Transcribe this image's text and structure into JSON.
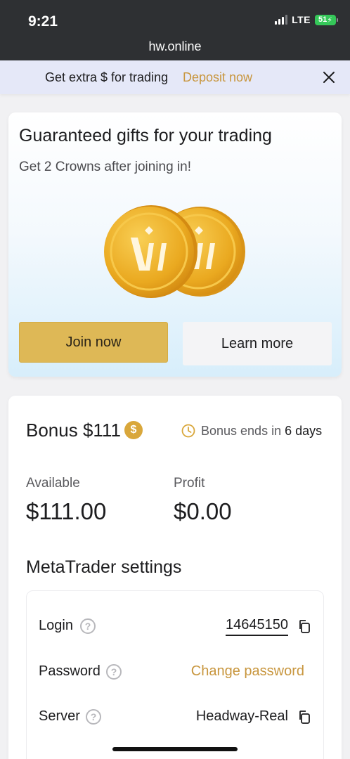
{
  "status_bar": {
    "time": "9:21",
    "network": "LTE",
    "battery": "51"
  },
  "browser": {
    "url": "hw.online"
  },
  "promo": {
    "text": "Get extra $ for trading",
    "link": "Deposit now"
  },
  "gift": {
    "title": "Guaranteed gifts for your trading",
    "subtitle": "Get 2 Crowns after joining in!",
    "join_label": "Join now",
    "learn_label": "Learn more"
  },
  "bonus": {
    "title": "Bonus $111",
    "ends_prefix": "Bonus ends in",
    "ends_days": "6 days",
    "available_label": "Available",
    "available_value": "$111.00",
    "profit_label": "Profit",
    "profit_value": "$0.00"
  },
  "metatrader": {
    "title": "MetaTrader settings",
    "login_label": "Login",
    "login_value": "14645150",
    "password_label": "Password",
    "change_password": "Change password",
    "server_label": "Server",
    "server_value": "Headway-Real"
  },
  "colors": {
    "accent": "#c8963e",
    "button_gold": "#deb856",
    "coin": "#f0b52c"
  }
}
